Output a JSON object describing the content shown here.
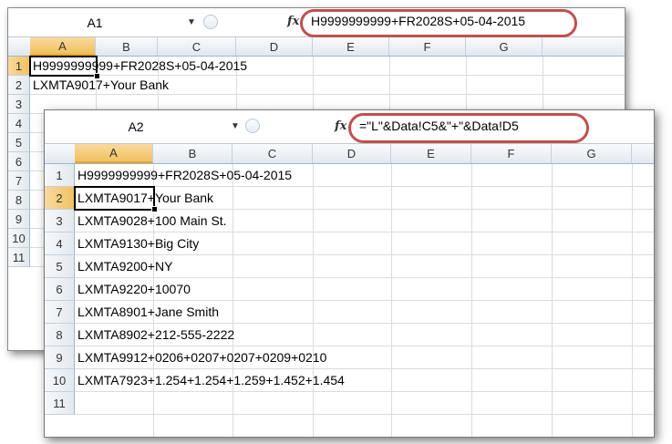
{
  "back_window": {
    "name_box": "A1",
    "fx_label": "fx",
    "formula": "H9999999999+FR2028S+05-04-2015",
    "columns": [
      "A",
      "B",
      "C",
      "D",
      "E",
      "F",
      "G"
    ],
    "rows": [
      {
        "num": "1",
        "a": "H9999999999+FR2028S+05-04-2015"
      },
      {
        "num": "2",
        "a": "LXMTA9017+Your Bank"
      },
      {
        "num": "3",
        "a": ""
      },
      {
        "num": "4",
        "a": ""
      },
      {
        "num": "5",
        "a": ""
      },
      {
        "num": "6",
        "a": ""
      },
      {
        "num": "7",
        "a": ""
      },
      {
        "num": "8",
        "a": ""
      },
      {
        "num": "9",
        "a": ""
      },
      {
        "num": "10",
        "a": ""
      },
      {
        "num": "11",
        "a": ""
      }
    ]
  },
  "front_window": {
    "name_box": "A2",
    "fx_label": "fx",
    "formula": "=\"L\"&Data!C5&\"+\"&Data!D5",
    "columns": [
      "A",
      "B",
      "C",
      "D",
      "E",
      "F",
      "G"
    ],
    "rows": [
      {
        "num": "1",
        "a": "H9999999999+FR2028S+05-04-2015"
      },
      {
        "num": "2",
        "a": "LXMTA9017+Your Bank"
      },
      {
        "num": "3",
        "a": "LXMTA9028+100 Main St."
      },
      {
        "num": "4",
        "a": "LXMTA9130+Big City"
      },
      {
        "num": "5",
        "a": "LXMTA9200+NY"
      },
      {
        "num": "6",
        "a": "LXMTA9220+10070"
      },
      {
        "num": "7",
        "a": "LXMTA8901+Jane Smith"
      },
      {
        "num": "8",
        "a": "LXMTA8902+212-555-2222"
      },
      {
        "num": "9",
        "a": "LXMTA9912+0206+0207+0207+0209+0210"
      },
      {
        "num": "10",
        "a": "LXMTA7923+1.254+1.254+1.259+1.452+1.454"
      },
      {
        "num": "11",
        "a": ""
      }
    ]
  },
  "colors": {
    "highlight_oval": "#c0504d",
    "selected_header": "#f1c15f"
  }
}
